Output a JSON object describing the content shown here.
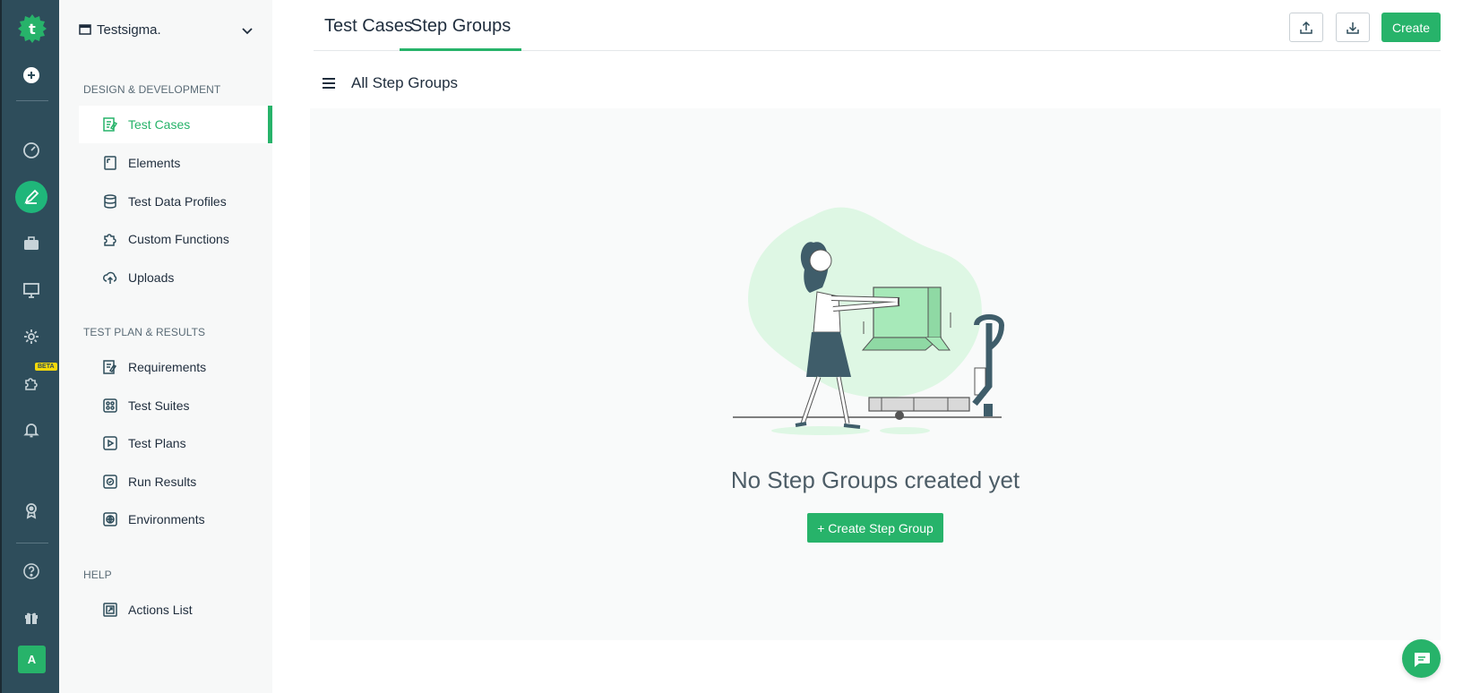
{
  "colors": {
    "rail_bg": "#2e4d5b",
    "accent": "#27b36a",
    "panel_bg": "#f7f8f8"
  },
  "rail": {
    "logo_letter": "t",
    "items": [
      {
        "name": "add-icon"
      },
      {
        "name": "dashboard-icon"
      },
      {
        "name": "design-icon"
      },
      {
        "name": "briefcase-icon"
      },
      {
        "name": "monitor-icon"
      },
      {
        "name": "settings-icon"
      },
      {
        "name": "addons-icon"
      },
      {
        "name": "bell-icon"
      },
      {
        "name": "award-icon"
      },
      {
        "name": "help-icon"
      },
      {
        "name": "gift-icon"
      }
    ],
    "beta_label": "BETA",
    "avatar_letter": "A"
  },
  "sidepanel": {
    "workspace": "Testsigma.",
    "sections": [
      {
        "title": "DESIGN & DEVELOPMENT",
        "items": [
          {
            "label": "Test Cases",
            "icon": "test-cases-icon",
            "active": true
          },
          {
            "label": "Elements",
            "icon": "elements-icon"
          },
          {
            "label": "Test Data Profiles",
            "icon": "database-icon"
          },
          {
            "label": "Custom Functions",
            "icon": "puzzle-icon"
          },
          {
            "label": "Uploads",
            "icon": "cloud-upload-icon"
          }
        ]
      },
      {
        "title": "TEST PLAN & RESULTS",
        "items": [
          {
            "label": "Requirements",
            "icon": "requirements-icon"
          },
          {
            "label": "Test Suites",
            "icon": "test-suites-icon"
          },
          {
            "label": "Test Plans",
            "icon": "test-plans-icon"
          },
          {
            "label": "Run Results",
            "icon": "run-results-icon"
          },
          {
            "label": "Environments",
            "icon": "environments-icon"
          }
        ]
      },
      {
        "title": "HELP",
        "items": [
          {
            "label": "Actions List",
            "icon": "actions-list-icon"
          }
        ]
      }
    ]
  },
  "tabs": {
    "test_cases": "Test Cases",
    "step_groups": "Step Groups"
  },
  "toolbar": {
    "create_label": "Create"
  },
  "subheader": {
    "title": "All Step Groups"
  },
  "empty_state": {
    "message": "No Step Groups created yet",
    "cta_label": "+ Create Step Group"
  }
}
